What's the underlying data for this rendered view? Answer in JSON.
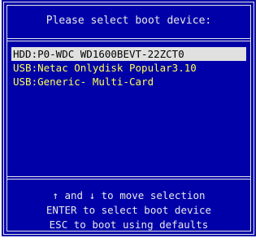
{
  "header": {
    "title": "Please select boot device:"
  },
  "devices": [
    {
      "label": "HDD:P0-WDC WD1600BEVT-22ZCT0",
      "selected": true
    },
    {
      "label": "USB:Netac Onlydisk Popular3.10",
      "selected": false
    },
    {
      "label": "USB:Generic- Multi-Card",
      "selected": false
    }
  ],
  "help": {
    "line1": "↑ and ↓ to move selection",
    "line2": "ENTER to select boot device",
    "line3": "ESC to boot using defaults"
  },
  "colors": {
    "background": "#0000a8",
    "border": "#e8e8e8",
    "item_text": "#ffff55",
    "selected_bg": "#e0e0e0",
    "selected_text": "#000000"
  }
}
